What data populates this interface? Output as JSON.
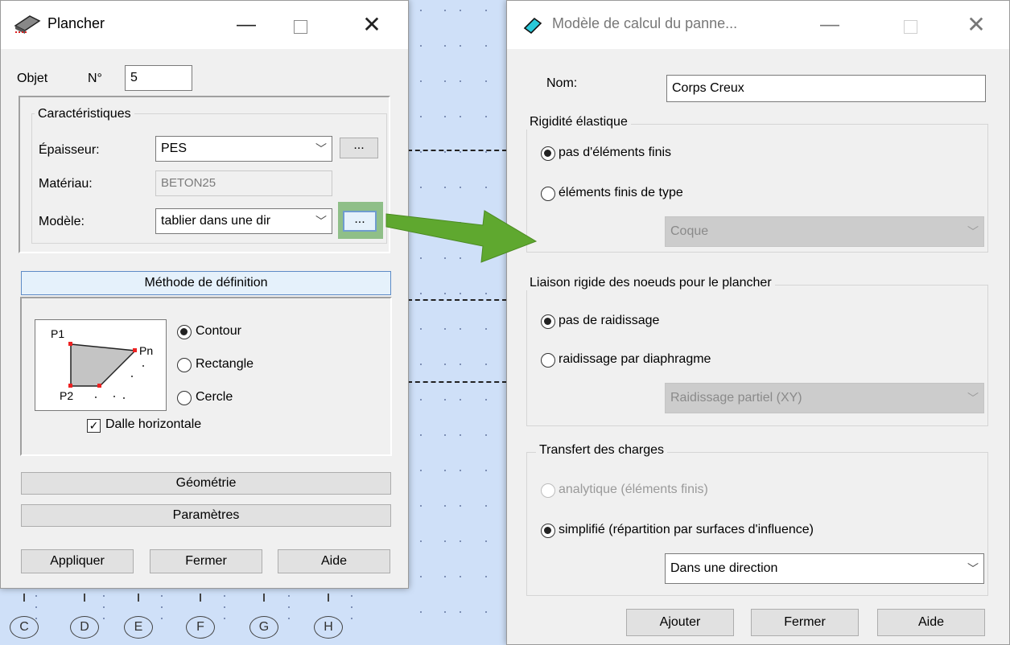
{
  "left_window": {
    "title": "Plancher",
    "object_label": "Objet",
    "number_label": "N°",
    "number_value": "5",
    "characteristics_title": "Caractéristiques",
    "thickness_label": "Épaisseur:",
    "thickness_value": "PES",
    "material_label": "Matériau:",
    "material_value": "BETON25",
    "model_label": "Modèle:",
    "model_value": "tablier dans une dir",
    "browse_label": "...",
    "method_header": "Méthode de définition",
    "diagram": {
      "p1": "P1",
      "pn": "Pn",
      "p2": "P2"
    },
    "options": [
      "Contour",
      "Rectangle",
      "Cercle"
    ],
    "selected_option": "Contour",
    "horizontal_slab_label": "Dalle horizontale",
    "horizontal_slab_checked": true,
    "geometry_label": "Géométrie",
    "parameters_label": "Paramètres",
    "apply_label": "Appliquer",
    "close_label": "Fermer",
    "help_label": "Aide"
  },
  "right_window": {
    "title": "Modèle de calcul du panne...",
    "name_label": "Nom:",
    "name_value": "Corps Creux",
    "elastic_title": "Rigidité élastique",
    "elastic_opt1": "pas d'éléments finis",
    "elastic_opt2": "éléments finis de type",
    "elastic_combo": "Coque",
    "link_title": "Liaison rigide des noeuds pour le plancher",
    "link_opt1": "pas de raidissage",
    "link_opt2": "raidissage par diaphragme",
    "link_combo": "Raidissage partiel (XY)",
    "transfer_title": "Transfert des charges",
    "transfer_opt1": "analytique (éléments finis)",
    "transfer_opt2": "simplifié (répartition par surfaces d'influence)",
    "transfer_combo": "Dans une direction",
    "add_label": "Ajouter",
    "close_label": "Fermer",
    "help_label": "Aide"
  },
  "axis_labels": [
    "C",
    "D",
    "E",
    "F",
    "G",
    "H"
  ],
  "colors": {
    "arrow": "#5fa82f",
    "highlight": "#8fbf88",
    "background": "#cfe0f8"
  }
}
